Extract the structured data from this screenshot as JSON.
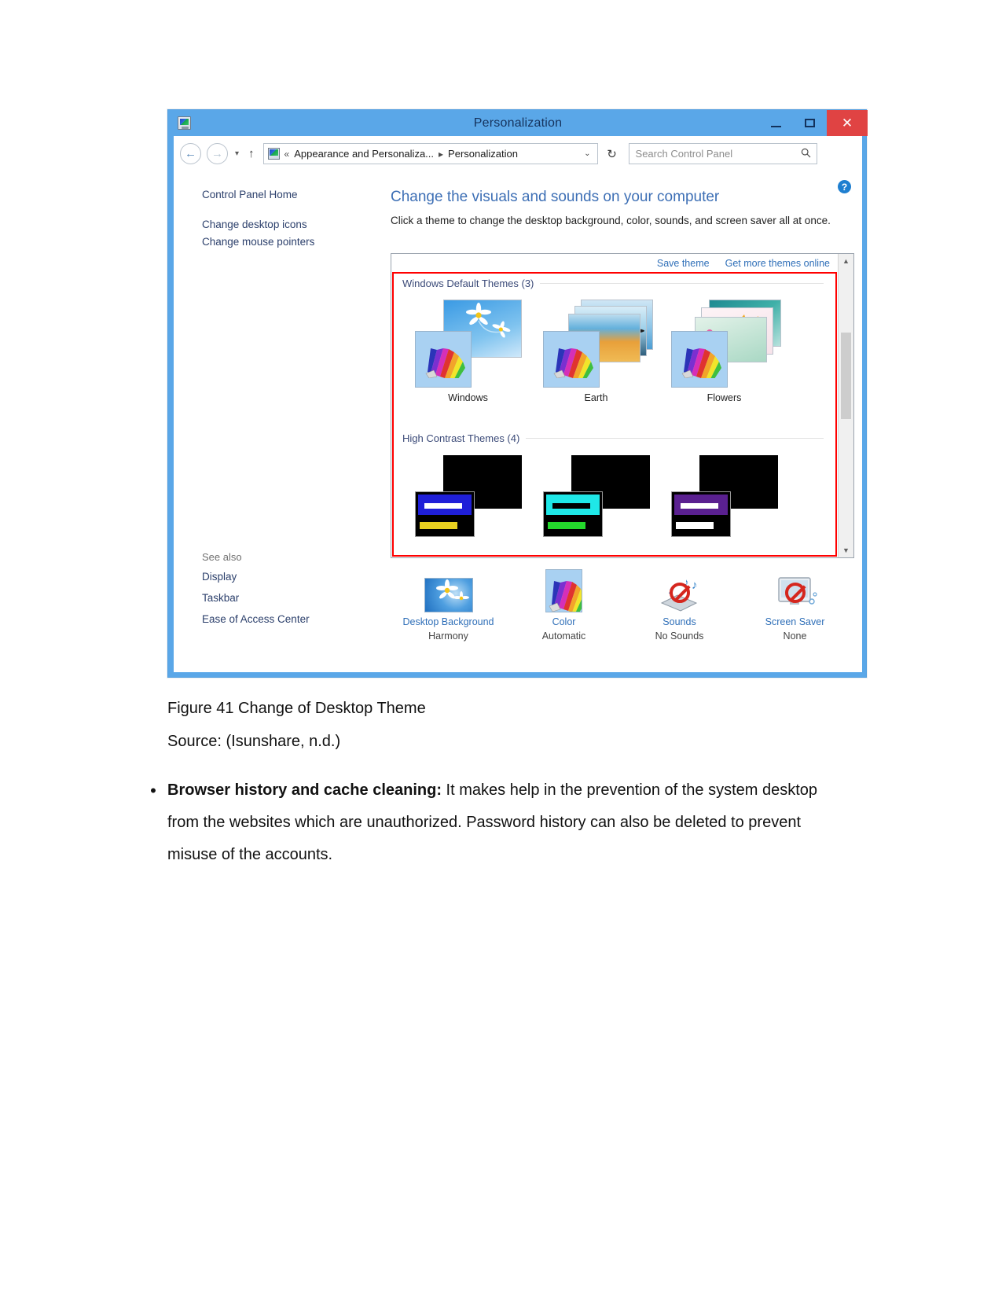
{
  "window": {
    "title": "Personalization",
    "icon": "personalization-icon",
    "minimize": "–",
    "maximize": "▢",
    "close": "✕"
  },
  "addressbar": {
    "back": "←",
    "forward": "→",
    "recent": "▾",
    "up": "↑",
    "breadcrumb_root": "«",
    "breadcrumb_1": "Appearance and Personaliza...",
    "breadcrumb_sep": "▸",
    "breadcrumb_2": "Personalization",
    "dropdown": "⌄",
    "refresh": "↻",
    "search_placeholder": "Search Control Panel",
    "search_value": "",
    "search_icon": "🔍"
  },
  "leftnav": {
    "home": "Control Panel Home",
    "items": [
      {
        "label": "Change desktop icons"
      },
      {
        "label": "Change mouse pointers"
      }
    ]
  },
  "seealso": {
    "heading": "See also",
    "items": [
      {
        "label": "Display"
      },
      {
        "label": "Taskbar"
      },
      {
        "label": "Ease of Access Center"
      }
    ]
  },
  "main": {
    "heading": "Change the visuals and sounds on your computer",
    "description": "Click a theme to change the desktop background, color, sounds, and screen saver all at once.",
    "help_icon": "?"
  },
  "themebox": {
    "save_theme": "Save theme",
    "get_more": "Get more themes online",
    "scroll_up": "▲",
    "scroll_down": "▼",
    "sections": [
      {
        "title": "Windows Default Themes (3)",
        "themes": [
          {
            "label": "Windows"
          },
          {
            "label": "Earth"
          },
          {
            "label": "Flowers"
          }
        ]
      },
      {
        "title": "High Contrast Themes (4)",
        "themes": [
          {
            "label": "",
            "accent": "#1f1fd8",
            "text": "#ffffff",
            "low": "#e8d020"
          },
          {
            "label": "",
            "accent": "#1fe8e8",
            "text": "#000000",
            "low": "#24d92c"
          },
          {
            "label": "",
            "accent": "#5a2090",
            "text": "#ffffff",
            "low": "#ffffff"
          }
        ]
      }
    ]
  },
  "bottom_items": [
    {
      "label": "Desktop Background",
      "value": "Harmony",
      "icon": "wallpaper-icon"
    },
    {
      "label": "Color",
      "value": "Automatic",
      "icon": "color-palette-icon"
    },
    {
      "label": "Sounds",
      "value": "No Sounds",
      "icon": "sounds-disabled-icon"
    },
    {
      "label": "Screen Saver",
      "value": "None",
      "icon": "screensaver-disabled-icon"
    }
  ],
  "document": {
    "figure_caption": "Figure 41 Change of Desktop Theme",
    "source_caption": "Source: (Isunshare, n.d.)",
    "bullet": {
      "marker": "•",
      "bold_lead": "Browser history and cache cleaning:",
      "body": " It makes help in the prevention of the system desktop from the websites which are unauthorized. Password history can also be deleted to prevent misuse of the accounts."
    }
  },
  "colors": {
    "window_chrome": "#5aa7e8",
    "close_button": "#e04343",
    "link_blue": "#2f6fb8",
    "heading_blue": "#3d6fb5",
    "highlight_red": "#ff0000"
  }
}
